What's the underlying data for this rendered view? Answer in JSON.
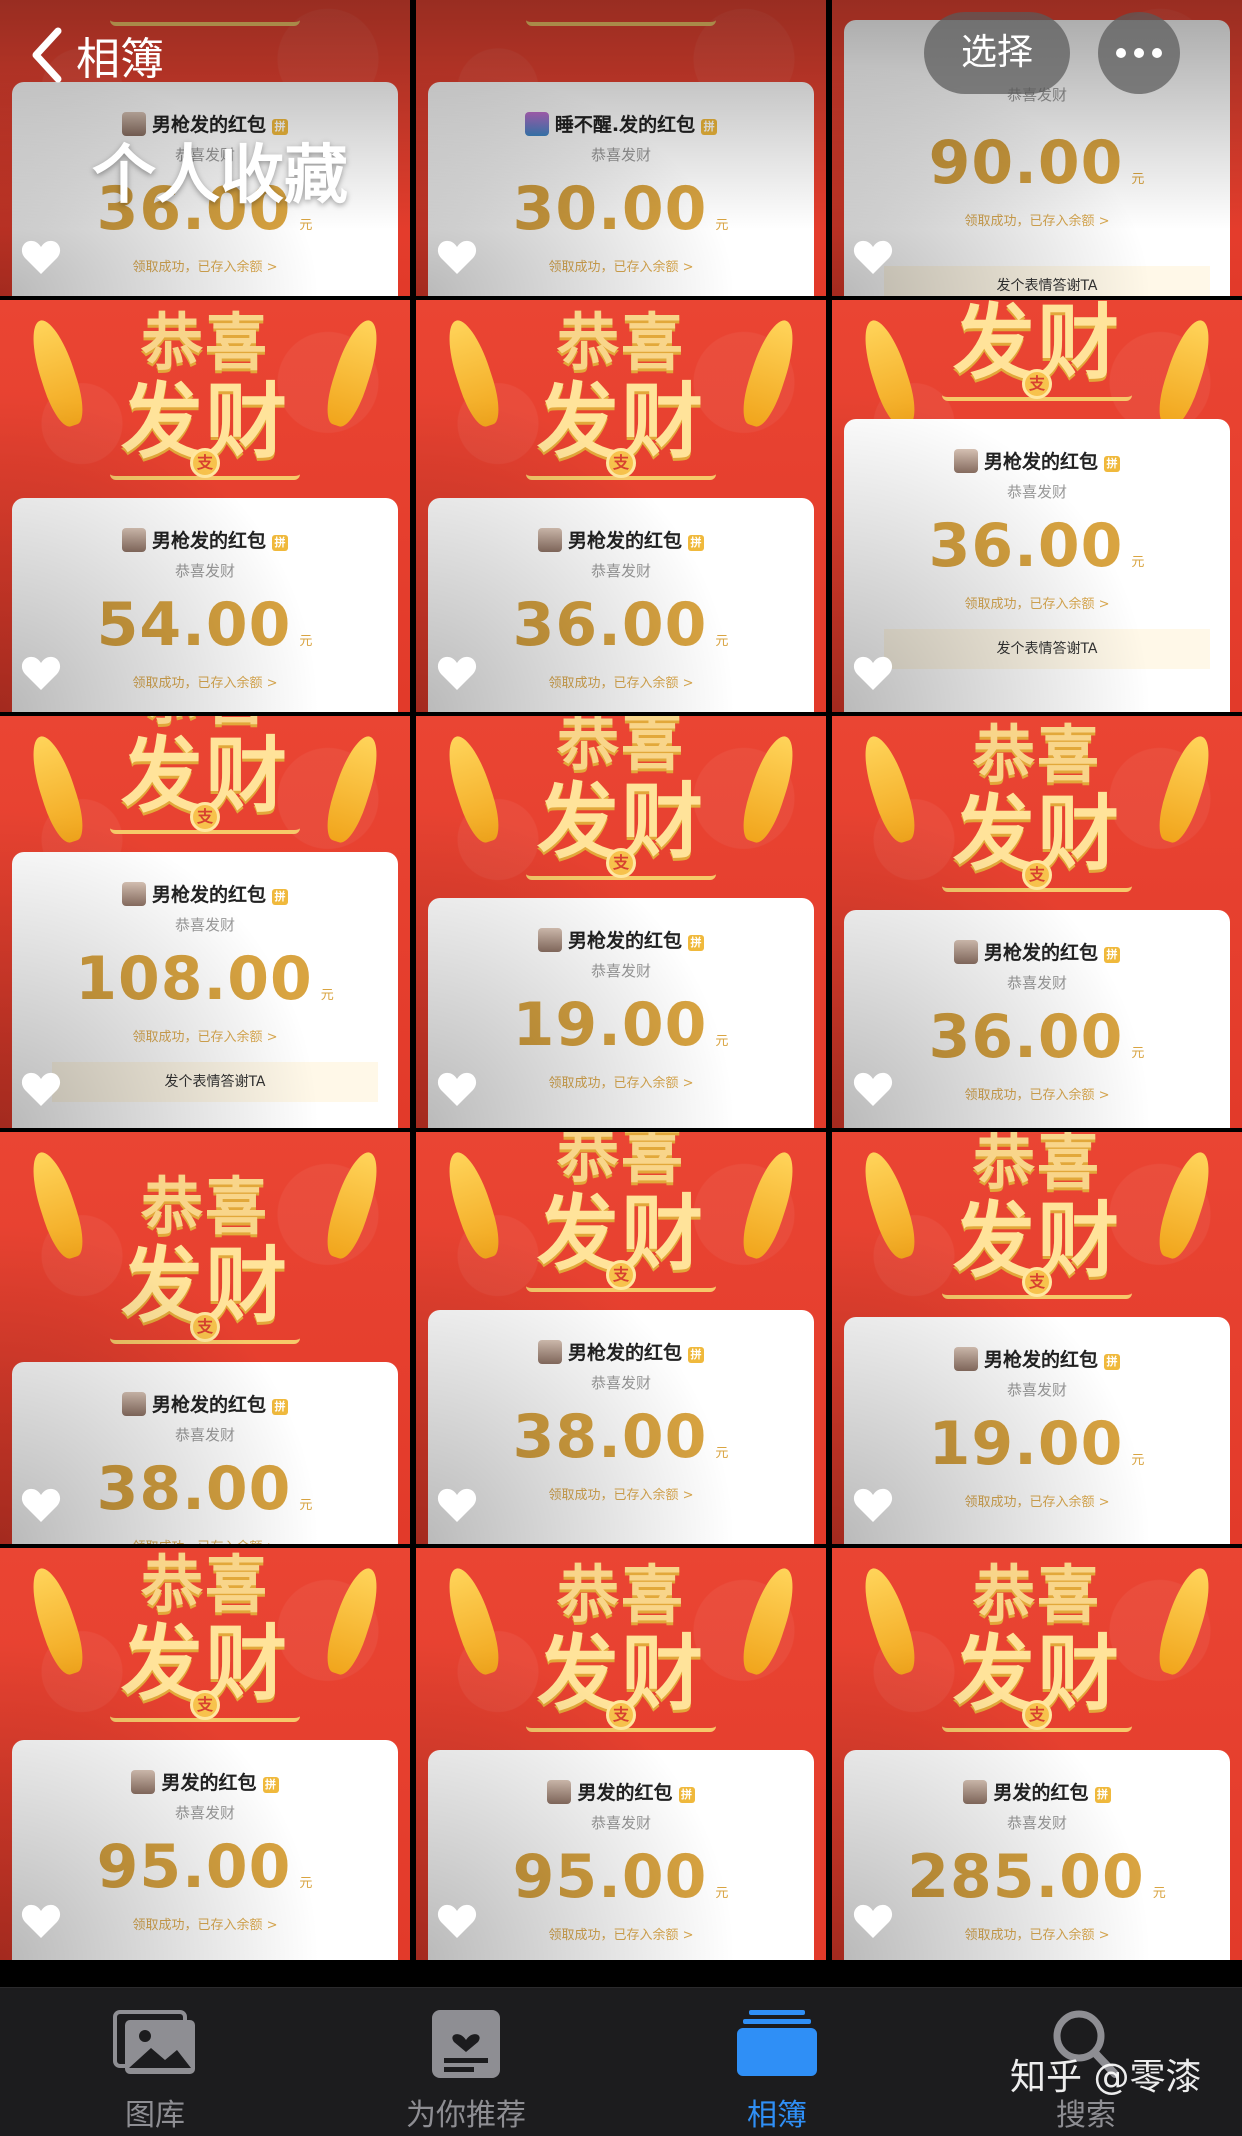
{
  "header": {
    "back_label": "相簿",
    "album_title": "个人收藏",
    "select_label": "选择"
  },
  "tiles": [
    {
      "sender": "男枪发的红包",
      "greeting": "恭喜发财",
      "amount": "36.00",
      "unit": "元",
      "status": "领取成功，已存入余额 >",
      "thanks": ""
    },
    {
      "sender": "睡不醒.发的红包",
      "greeting": "恭喜发财",
      "amount": "30.00",
      "unit": "元",
      "status": "领取成功，已存入余额 >",
      "thanks": ""
    },
    {
      "sender": "",
      "greeting": "恭喜发财",
      "amount": "90.00",
      "unit": "元",
      "status": "领取成功，已存入余额 >",
      "thanks": "发个表情答谢TA"
    },
    {
      "sender": "男枪发的红包",
      "greeting": "恭喜发财",
      "amount": "54.00",
      "unit": "元",
      "status": "领取成功，已存入余额 >",
      "thanks": ""
    },
    {
      "sender": "男枪发的红包",
      "greeting": "恭喜发财",
      "amount": "36.00",
      "unit": "元",
      "status": "领取成功，已存入余额 >",
      "thanks": ""
    },
    {
      "sender": "男枪发的红包",
      "greeting": "恭喜发财",
      "amount": "36.00",
      "unit": "元",
      "status": "领取成功，已存入余额 >",
      "thanks": "发个表情答谢TA"
    },
    {
      "sender": "男枪发的红包",
      "greeting": "恭喜发财",
      "amount": "108.00",
      "unit": "元",
      "status": "领取成功，已存入余额 >",
      "thanks": "发个表情答谢TA"
    },
    {
      "sender": "男枪发的红包",
      "greeting": "恭喜发财",
      "amount": "19.00",
      "unit": "元",
      "status": "领取成功，已存入余额 >",
      "thanks": ""
    },
    {
      "sender": "男枪发的红包",
      "greeting": "恭喜发财",
      "amount": "36.00",
      "unit": "元",
      "status": "领取成功，已存入余额 >",
      "thanks": ""
    },
    {
      "sender": "男枪发的红包",
      "greeting": "恭喜发财",
      "amount": "38.00",
      "unit": "元",
      "status": "领取成功，已存入余额 >",
      "thanks": ""
    },
    {
      "sender": "男枪发的红包",
      "greeting": "恭喜发财",
      "amount": "38.00",
      "unit": "元",
      "status": "领取成功，已存入余额 >",
      "thanks": ""
    },
    {
      "sender": "男枪发的红包",
      "greeting": "恭喜发财",
      "amount": "19.00",
      "unit": "元",
      "status": "领取成功，已存入余额 >",
      "thanks": ""
    },
    {
      "sender": "男发的红包",
      "greeting": "恭喜发财",
      "amount": "95.00",
      "unit": "元",
      "status": "领取成功，已存入余额 >",
      "thanks": ""
    },
    {
      "sender": "男发的红包",
      "greeting": "恭喜发财",
      "amount": "95.00",
      "unit": "元",
      "status": "领取成功，已存入余额 >",
      "thanks": ""
    },
    {
      "sender": "男发的红包",
      "greeting": "恭喜发财",
      "amount": "285.00",
      "unit": "元",
      "status": "领取成功，已存入余额 >",
      "thanks": ""
    }
  ],
  "banner": {
    "line1": "恭喜",
    "line2": "发财",
    "coin_glyph": "支",
    "pin_glyph": "拼"
  },
  "tabbar": {
    "items": [
      {
        "label": "图库",
        "icon": "photo-library-icon",
        "active": false
      },
      {
        "label": "为你推荐",
        "icon": "for-you-icon",
        "active": false
      },
      {
        "label": "相簿",
        "icon": "albums-icon",
        "active": true
      },
      {
        "label": "搜索",
        "icon": "search-icon",
        "active": false
      }
    ]
  },
  "watermark": "知乎 @零漆",
  "colors": {
    "accent": "#2f8ff6",
    "gold": "#d9a441",
    "red": "#e8402f"
  }
}
